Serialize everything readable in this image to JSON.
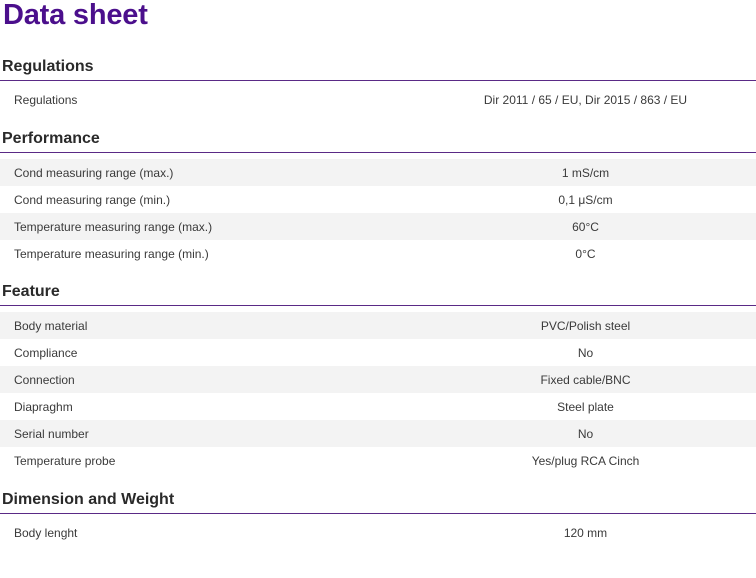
{
  "page": {
    "title": "Data sheet"
  },
  "sections": {
    "regulations": {
      "title": "Regulations",
      "rows": [
        {
          "label": "Regulations",
          "value": "Dir 2011 / 65 / EU, Dir 2015 / 863 / EU"
        }
      ]
    },
    "performance": {
      "title": "Performance",
      "rows": [
        {
          "label": "Cond measuring range (max.)",
          "value": "1 mS/cm"
        },
        {
          "label": "Cond measuring range (min.)",
          "value": "0,1 μS/cm"
        },
        {
          "label": "Temperature measuring range (max.)",
          "value": "60°C"
        },
        {
          "label": "Temperature measuring range (min.)",
          "value": "0°C"
        }
      ]
    },
    "feature": {
      "title": "Feature",
      "rows": [
        {
          "label": "Body material",
          "value": "PVC/Polish steel"
        },
        {
          "label": "Compliance",
          "value": "No"
        },
        {
          "label": "Connection",
          "value": "Fixed cable/BNC"
        },
        {
          "label": "Diapraghm",
          "value": "Steel plate"
        },
        {
          "label": "Serial number",
          "value": "No"
        },
        {
          "label": "Temperature probe",
          "value": "Yes/plug RCA Cinch"
        }
      ]
    },
    "dimension": {
      "title": "Dimension and Weight",
      "rows": [
        {
          "label": "Body lenght",
          "value": "120 mm"
        }
      ]
    }
  },
  "colors": {
    "title": "#4b0f8c",
    "rule": "#5a2a86",
    "stripe": "#f3f3f3"
  }
}
